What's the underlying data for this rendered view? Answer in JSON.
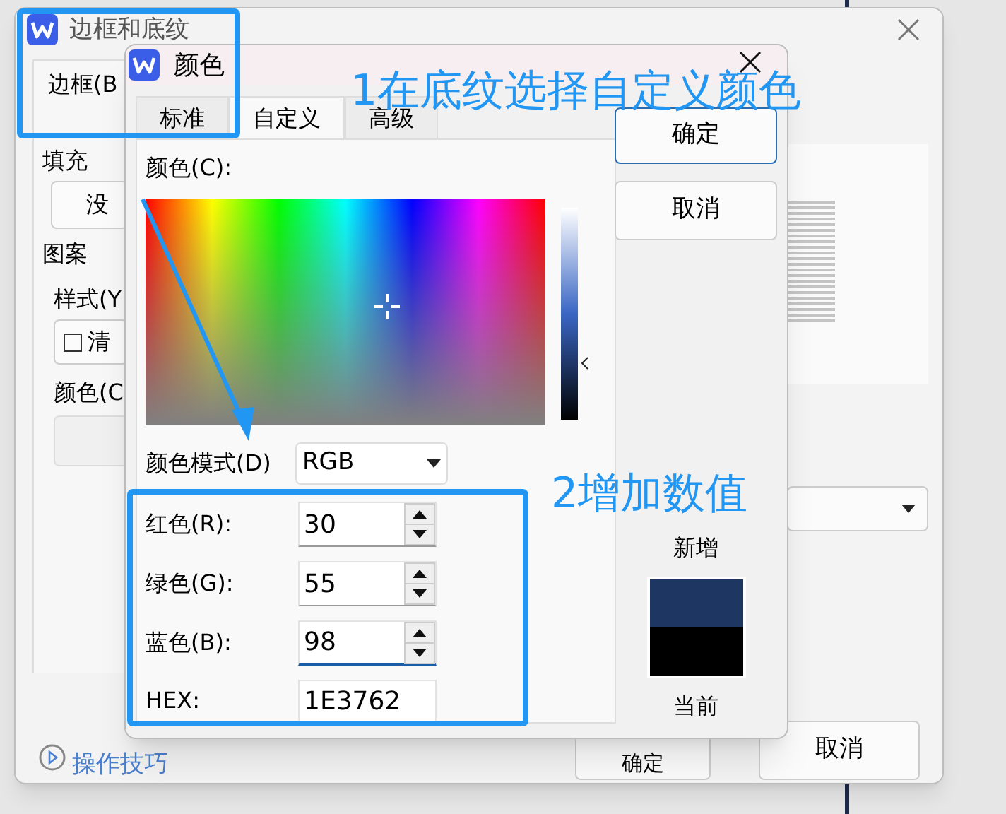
{
  "back_window": {
    "title": "边框和底纹",
    "tab": "边框(B",
    "fill_label": "填充",
    "fill_button": "没",
    "pattern_label": "图案",
    "style_label": "样式(Y",
    "style_value": "清",
    "color_label": "颜色(C",
    "tips_link": "操作技巧",
    "ok_button": "确定",
    "cancel_button": "取消"
  },
  "color_dialog": {
    "title": "颜色",
    "tabs": [
      {
        "label": "标准",
        "selected": false
      },
      {
        "label": "自定义",
        "selected": true
      },
      {
        "label": "高级",
        "selected": false
      }
    ],
    "color_label": "颜色(C):",
    "mode_label": "颜色模式(D)",
    "mode_value": "RGB",
    "channels": [
      {
        "label": "红色(R):",
        "value": "30",
        "focused": false
      },
      {
        "label": "绿色(G):",
        "value": "55",
        "focused": false
      },
      {
        "label": "蓝色(B):",
        "value": "98",
        "focused": true
      }
    ],
    "hex_label": "HEX:",
    "hex_value": "1E3762",
    "ok_button": "确定",
    "cancel_button": "取消",
    "swatches": [
      {
        "label": "新增",
        "color": "#1e3762"
      },
      {
        "label": "当前",
        "color": "#000000"
      }
    ]
  },
  "annotations": [
    {
      "text": "1在底纹选择自定义颜色"
    },
    {
      "text": "2增加数值"
    }
  ]
}
